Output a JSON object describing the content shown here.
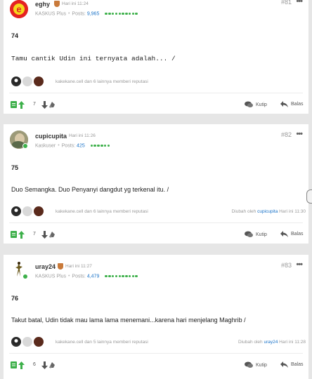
{
  "posts": [
    {
      "username": "eghy",
      "time": "Hari ini 11:24",
      "rank": "KASKUS Plus",
      "posts_label": "Posts:",
      "post_count": "9,965",
      "reputation_bars": 10,
      "post_number": "#81",
      "menu": "•••",
      "title": "74",
      "body": "Tamu cantik Udin ini ternyata adalah... /",
      "reputation_text": "kakekane.cell dan 6 lainnya memberi reputasi",
      "edited_prefix": "",
      "edited_user": "",
      "edited_time": "",
      "vote_count": "7",
      "quote_label": "Kutip",
      "reply_label": "Balas"
    },
    {
      "username": "cupicupita",
      "time": "Hari ini 11:26",
      "rank": "Kaskuser",
      "posts_label": "Posts:",
      "post_count": "425",
      "reputation_bars": 6,
      "post_number": "#82",
      "menu": "•••",
      "title": "75",
      "body": "Duo Semangka. Duo Penyanyi dangdut yg terkenal itu. /",
      "reputation_text": "kakekane.cell dan 6 lainnya memberi reputasi",
      "edited_prefix": "Diubah oleh",
      "edited_user": "cupicupita",
      "edited_time": "Hari ini 11:30",
      "vote_count": "7",
      "quote_label": "Kutip",
      "reply_label": "Balas"
    },
    {
      "username": "uray24",
      "time": "Hari ini 11:27",
      "rank": "KASKUS Plus",
      "posts_label": "Posts:",
      "post_count": "4,479",
      "reputation_bars": 10,
      "post_number": "#83",
      "menu": "•••",
      "title": "76",
      "body": "Takut batal, Udin tidak mau lama lama menemani...karena hari menjelang Maghrib /",
      "reputation_text": "kakekane.cell dan 5 lainnya memberi reputasi",
      "edited_prefix": "Diubah oleh",
      "edited_user": "uray24",
      "edited_time": "Hari ini 11:28",
      "vote_count": "6",
      "quote_label": "Kutip",
      "reply_label": "Balas"
    }
  ],
  "colors": {
    "accent_blue": "#1a73c8",
    "online_green": "#3db04a",
    "muted": "#9a9a9a"
  }
}
